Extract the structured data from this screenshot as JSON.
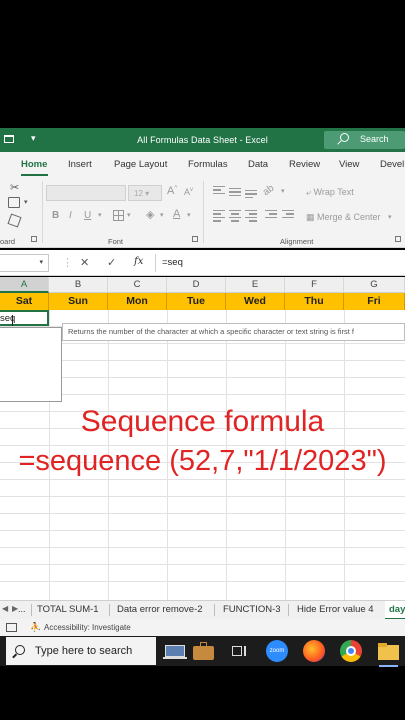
{
  "window": {
    "title": "All Formulas Data Sheet  -  Excel",
    "search_label": "Search"
  },
  "ribbon_tabs": [
    "Home",
    "Insert",
    "Page Layout",
    "Formulas",
    "Data",
    "Review",
    "View",
    "Devel"
  ],
  "ribbon": {
    "font_size": "12",
    "wrap_text": "Wrap Text",
    "merge_center": "Merge & Center",
    "groups": {
      "clipboard": "oard",
      "font": "Font",
      "alignment": "Alignment"
    }
  },
  "formula_bar": {
    "name_box": "",
    "cancel_icon": "✕",
    "enter_icon": "✓",
    "fx": "fx",
    "content": "=seq"
  },
  "columns": [
    "A",
    "B",
    "C",
    "D",
    "E",
    "F",
    "G"
  ],
  "day_headers": [
    "Sat",
    "Sun",
    "Mon",
    "Tue",
    "Wed",
    "Thu",
    "Fri"
  ],
  "active_cell_text": "seq",
  "tooltip": "Returns the number of the character at which a specific character or text string is first f",
  "overlay": {
    "line1": "Sequence formula",
    "line2": "=sequence (52,7,\"1/1/2023\")",
    "color": "#e02424"
  },
  "sheet_tabs": {
    "more": "...",
    "tabs": [
      "TOTAL SUM-1",
      "Data error remove-2",
      "FUNCTION-3",
      "Hide Error value 4"
    ],
    "active": "day"
  },
  "status": {
    "accessibility": "Accessibility: Investigate"
  },
  "taskbar": {
    "search_placeholder": "Type here to search",
    "zoom_label": "zoom"
  },
  "colors": {
    "excel_green": "#217346",
    "day_header_fill": "#ffc000"
  }
}
